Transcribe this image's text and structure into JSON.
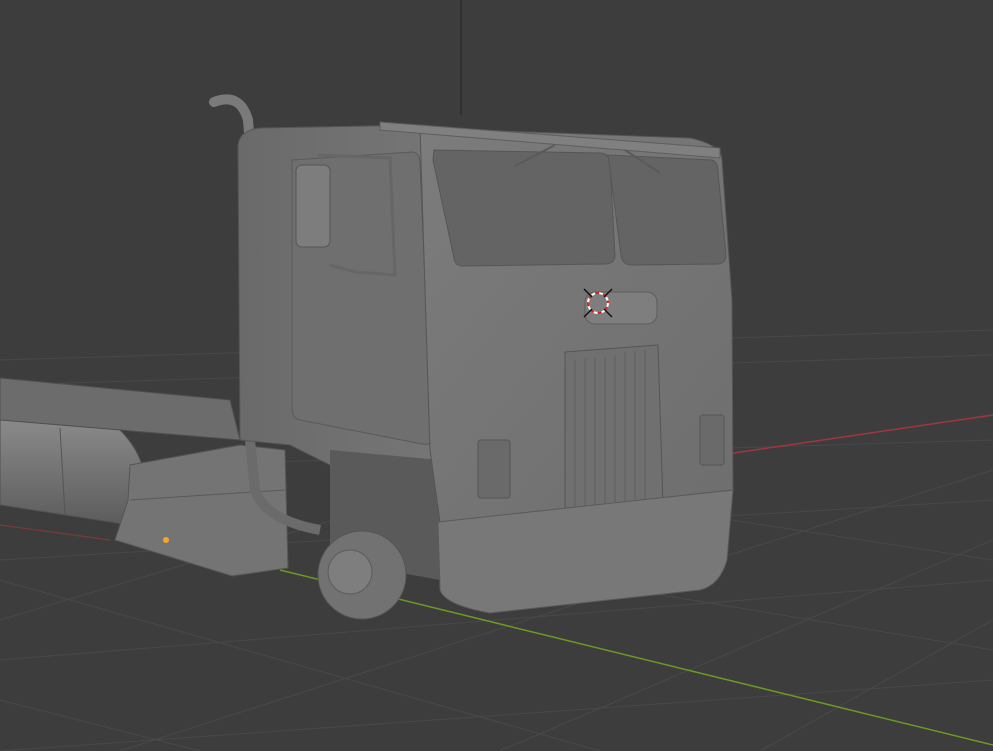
{
  "viewport": {
    "mode": "solid-shading",
    "background_color": "#3d3d3d",
    "grid_color": "#4a4a4a",
    "x_axis_color": "#a3353d",
    "y_axis_color": "#6a9a23",
    "model_color": "#7a7a7a",
    "origin_color": "#f5a623",
    "icons": [
      "3d-cursor-icon",
      "object-origin-icon"
    ]
  }
}
